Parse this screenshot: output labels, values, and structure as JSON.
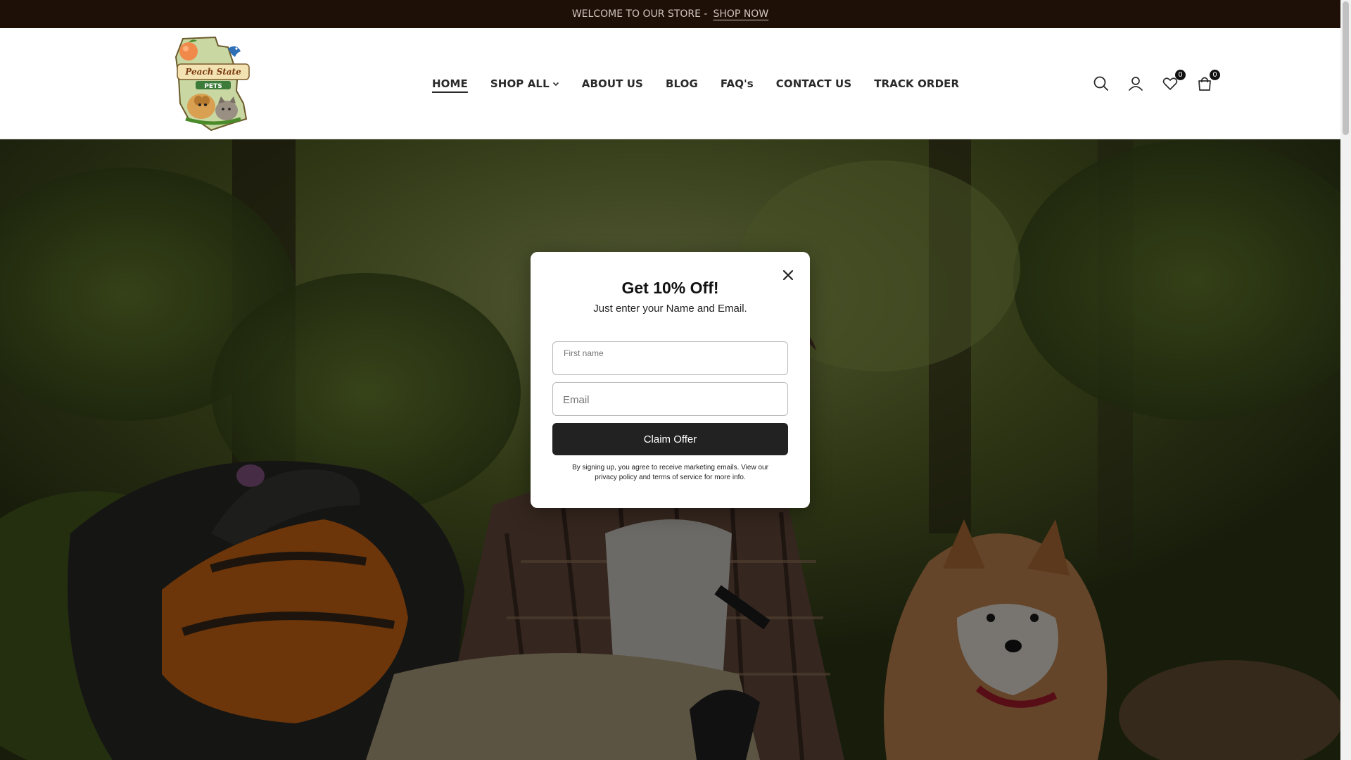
{
  "announcement": {
    "text": "WELCOME TO OUR STORE -",
    "link": "SHOP NOW"
  },
  "logo": {
    "text_line1": "Peach State",
    "text_line2": "PETS"
  },
  "nav": [
    {
      "label": "HOME",
      "active": true
    },
    {
      "label": "SHOP ALL",
      "dropdown": true
    },
    {
      "label": "ABOUT US"
    },
    {
      "label": "BLOG"
    },
    {
      "label": "FAQ's"
    },
    {
      "label": "CONTACT US"
    },
    {
      "label": "TRACK ORDER"
    }
  ],
  "header_icons": {
    "search": "search-icon",
    "account": "user-icon",
    "wishlist": {
      "icon": "heart-icon",
      "count": "0"
    },
    "cart": {
      "icon": "shopping-bag-icon",
      "count": "0"
    }
  },
  "popup": {
    "title": "Get 10% Off!",
    "subtitle": "Just enter your Name and Email.",
    "first_name_label": "First name",
    "first_name_value": "",
    "email_placeholder": "Email",
    "button": "Claim Offer",
    "legal": "By signing up, you agree to receive marketing emails. View our privacy policy and terms of service for more info."
  },
  "colors": {
    "announcement_bg": "#1e0f07",
    "button_bg": "#222222",
    "overlay": "rgba(0,0,0,0.5)"
  }
}
